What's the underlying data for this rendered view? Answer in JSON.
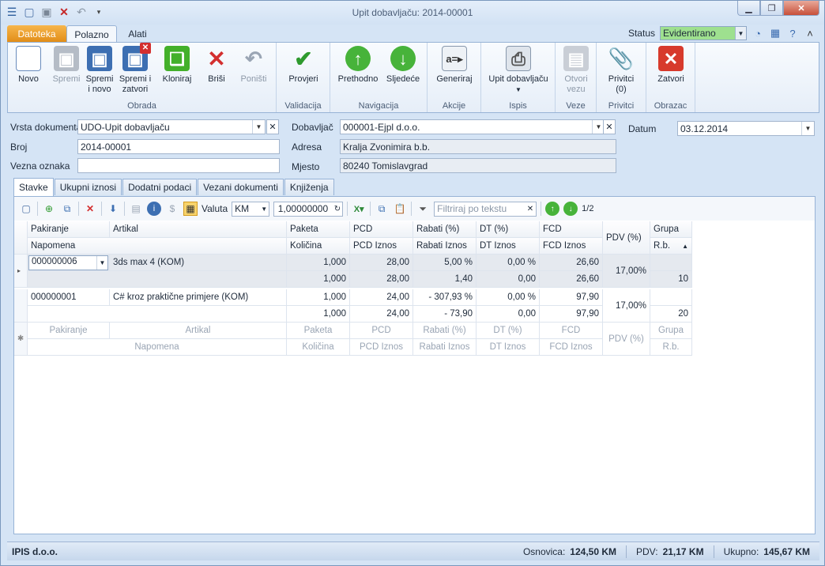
{
  "window": {
    "title": "Upit dobavljaču: 2014-00001"
  },
  "ribbon_tabs": [
    "Datoteka",
    "Polazno",
    "Alati"
  ],
  "status": {
    "label": "Status",
    "value": "Evidentirano",
    "color": "#9ee08f"
  },
  "groups": {
    "obrada": "Obrada",
    "validacija": "Validacija",
    "navigacija": "Navigacija",
    "akcije": "Akcije",
    "ispis": "Ispis",
    "veze": "Veze",
    "privitci": "Privitci",
    "obrazac": "Obrazac"
  },
  "buttons": {
    "novo": "Novo",
    "spremi": "Spremi",
    "spremi_novo_1": "Spremi",
    "spremi_novo_2": "i novo",
    "spremi_zatvori_1": "Spremi i",
    "spremi_zatvori_2": "zatvori",
    "kloniraj": "Kloniraj",
    "brisi": "Briši",
    "ponisti": "Poništi",
    "provjeri": "Provjeri",
    "prethodno": "Prethodno",
    "sljedece": "Sljedeće",
    "generiraj": "Generiraj",
    "upit": "Upit dobavljaču",
    "otvori_1": "Otvori",
    "otvori_2": "vezu",
    "privitci_1": "Privitci",
    "privitci_2": "(0)",
    "zatvori": "Zatvori"
  },
  "form": {
    "vrsta_label": "Vrsta dokumenta",
    "vrsta_value": "UDO-Upit dobavljaču",
    "broj_label": "Broj",
    "broj_value": "2014-00001",
    "vezna_label": "Vezna oznaka",
    "vezna_value": "",
    "dobavljac_label": "Dobavljač",
    "dobavljac_value": "000001-Ejpl d.o.o.",
    "adresa_label": "Adresa",
    "adresa_value": "Kralja Zvonimira b.b.",
    "mjesto_label": "Mjesto",
    "mjesto_value": "80240 Tomislavgrad",
    "datum_label": "Datum",
    "datum_value": "03.12.2014"
  },
  "subtabs": [
    "Stavke",
    "Ukupni iznosi",
    "Dodatni podaci",
    "Vezani dokumenti",
    "Knjiženja"
  ],
  "grid_toolbar": {
    "valuta_label": "Valuta",
    "valuta_value": "KM",
    "tecaj": "1,00000000",
    "filter_placeholder": "Filtriraj po tekstu",
    "pager": "1/2"
  },
  "columns": {
    "top": [
      "Pakiranje",
      "Artikal",
      "Paketa",
      "PCD",
      "Rabati (%)",
      "DT (%)",
      "FCD",
      "PDV (%)",
      "Grupa"
    ],
    "bottom": [
      "Napomena",
      "",
      "Količina",
      "PCD Iznos",
      "Rabati Iznos",
      "DT Iznos",
      "FCD Iznos",
      "",
      "R.b."
    ]
  },
  "rows": [
    {
      "pakiranje": "000000006",
      "artikal": "3ds max 4 (KOM)",
      "paketa": "1,000",
      "pcd": "28,00",
      "rabati": "5,00 %",
      "dt": "0,00 %",
      "fcd": "26,60",
      "pdv": "17,00%",
      "grupa": "",
      "kolicina": "1,000",
      "pcd_iznos": "28,00",
      "rabati_iznos": "1,40",
      "dt_iznos": "0,00",
      "fcd_iznos": "26,60",
      "rb": "10"
    },
    {
      "pakiranje": "000000001",
      "artikal": "C# kroz praktične primjere (KOM)",
      "paketa": "1,000",
      "pcd": "24,00",
      "rabati": "- 307,93 %",
      "dt": "0,00 %",
      "fcd": "97,90",
      "pdv": "17,00%",
      "grupa": "",
      "kolicina": "1,000",
      "pcd_iznos": "24,00",
      "rabati_iznos": "- 73,90",
      "dt_iznos": "0,00",
      "fcd_iznos": "97,90",
      "rb": "20"
    }
  ],
  "new_row": {
    "top": [
      "Pakiranje",
      "Artikal",
      "Paketa",
      "PCD",
      "Rabati (%)",
      "DT (%)",
      "FCD",
      "PDV (%)",
      "Grupa"
    ],
    "bottom": [
      "Napomena",
      "Količina",
      "PCD Iznos",
      "Rabati Iznos",
      "DT Iznos",
      "FCD Iznos",
      "R.b."
    ]
  },
  "statusbar": {
    "company": "IPIS d.o.o.",
    "osnovica_label": "Osnovica:",
    "osnovica": "124,50 KM",
    "pdv_label": "PDV:",
    "pdv": "21,17 KM",
    "ukupno_label": "Ukupno:",
    "ukupno": "145,67 KM"
  }
}
